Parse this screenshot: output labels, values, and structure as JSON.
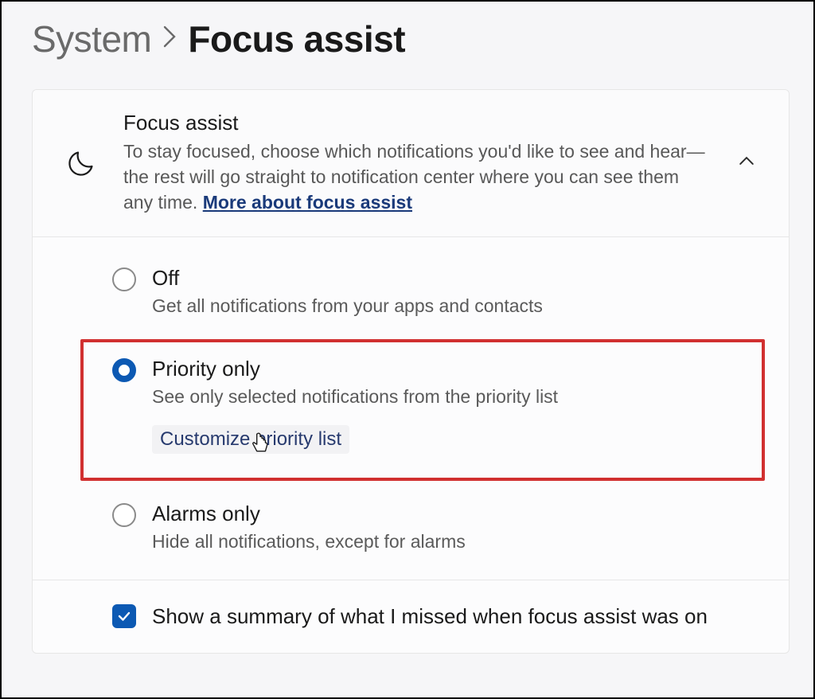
{
  "breadcrumb": {
    "parent": "System",
    "current": "Focus assist"
  },
  "header": {
    "title": "Focus assist",
    "description": "To stay focused, choose which notifications you'd like to see and hear—the rest will go straight to notification center where you can see them any time.  ",
    "more_link": "More about focus assist"
  },
  "options": {
    "off": {
      "title": "Off",
      "desc": "Get all notifications from your apps and contacts"
    },
    "priority": {
      "title": "Priority only",
      "desc": "See only selected notifications from the priority list",
      "customize": "Customize priority list"
    },
    "alarms": {
      "title": "Alarms only",
      "desc": "Hide all notifications, except for alarms"
    }
  },
  "summary": {
    "label": "Show a summary of what I missed when focus assist was on"
  }
}
